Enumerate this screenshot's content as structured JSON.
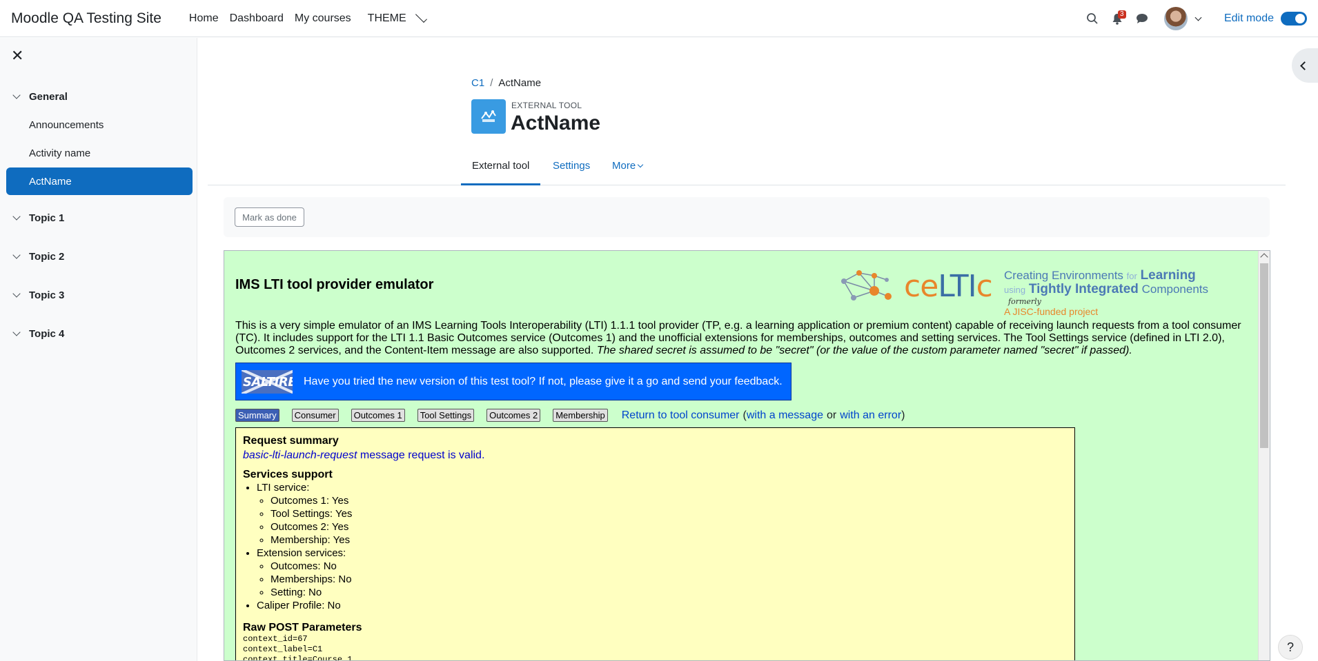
{
  "navbar": {
    "brand": "Moodle QA Testing Site",
    "items": [
      "Home",
      "Dashboard",
      "My courses",
      "THEME"
    ],
    "notification_count": "3",
    "edit_mode_label": "Edit mode"
  },
  "drawer": {
    "sections": [
      {
        "title": "General",
        "activities": [
          "Announcements",
          "Activity name",
          "ActName"
        ]
      },
      {
        "title": "Topic 1"
      },
      {
        "title": "Topic 2"
      },
      {
        "title": "Topic 3"
      },
      {
        "title": "Topic 4"
      }
    ]
  },
  "header": {
    "breadcrumb": [
      "C1",
      "ActName"
    ],
    "activity_kind": "EXTERNAL TOOL",
    "title": "ActName"
  },
  "secondary_nav": {
    "tabs": [
      "External tool",
      "Settings",
      "More"
    ]
  },
  "completion": {
    "button_label": "Mark as done"
  },
  "lti": {
    "title": "IMS LTI tool provider emulator",
    "logo": {
      "brand_prefix": "ce",
      "brand_main": "LTI",
      "brand_suffix": "c",
      "tag_line1_a": "Creating Environments",
      "tag_line1_b": "for",
      "tag_line1_c": "Learning",
      "tag_line2_a": "using",
      "tag_line2_b": "Tightly Integrated",
      "tag_line2_c": "Components",
      "formerly": "formerly",
      "jisc": "A JISC-funded project"
    },
    "intro": "This is a very simple emulator of an IMS Learning Tools Interoperability (LTI) 1.1.1 tool provider (TP, e.g. a learning application or premium content) capable of receiving launch requests from a tool consumer (TC). It includes support for the LTI 1.1 Basic Outcomes service (Outcomes 1) and the unofficial extensions for memberships, outcomes and setting services. The Tool Settings service (defined in LTI 2.0), Outcomes 2 services, and the Content-Item message are also supported.",
    "intro_em": "The shared secret is assumed to be \"secret\" (or the value of the custom parameter named \"secret\" if passed).",
    "saltire_logo": "SALTIRE",
    "saltire_text": "Have you tried the new version of this test tool? If not, please give it a go and send your feedback.",
    "tabs": [
      "Summary",
      "Consumer",
      "Outcomes 1",
      "Tool Settings",
      "Outcomes 2",
      "Membership"
    ],
    "return_link": "Return to tool consumer",
    "paren_open": "(",
    "msg_link": "with a message",
    "or": "or",
    "err_link": "with an error",
    "paren_close": ")",
    "summary": {
      "heading": "Request summary",
      "valid_em": "basic-lti-launch-request",
      "valid_rest": "message request is valid.",
      "services_heading": "Services support",
      "lti_service": "LTI service:",
      "lti_items": [
        "Outcomes 1: Yes",
        "Tool Settings: Yes",
        "Outcomes 2: Yes",
        "Membership: Yes"
      ],
      "ext_service": "Extension services:",
      "ext_items": [
        "Outcomes: No",
        "Memberships: No",
        "Setting: No"
      ],
      "caliper": "Caliper Profile: No",
      "raw_heading": "Raw POST Parameters",
      "raw_lines": [
        "context_id=67",
        "context_label=C1",
        "context_title=Course 1"
      ]
    }
  },
  "help": "?"
}
